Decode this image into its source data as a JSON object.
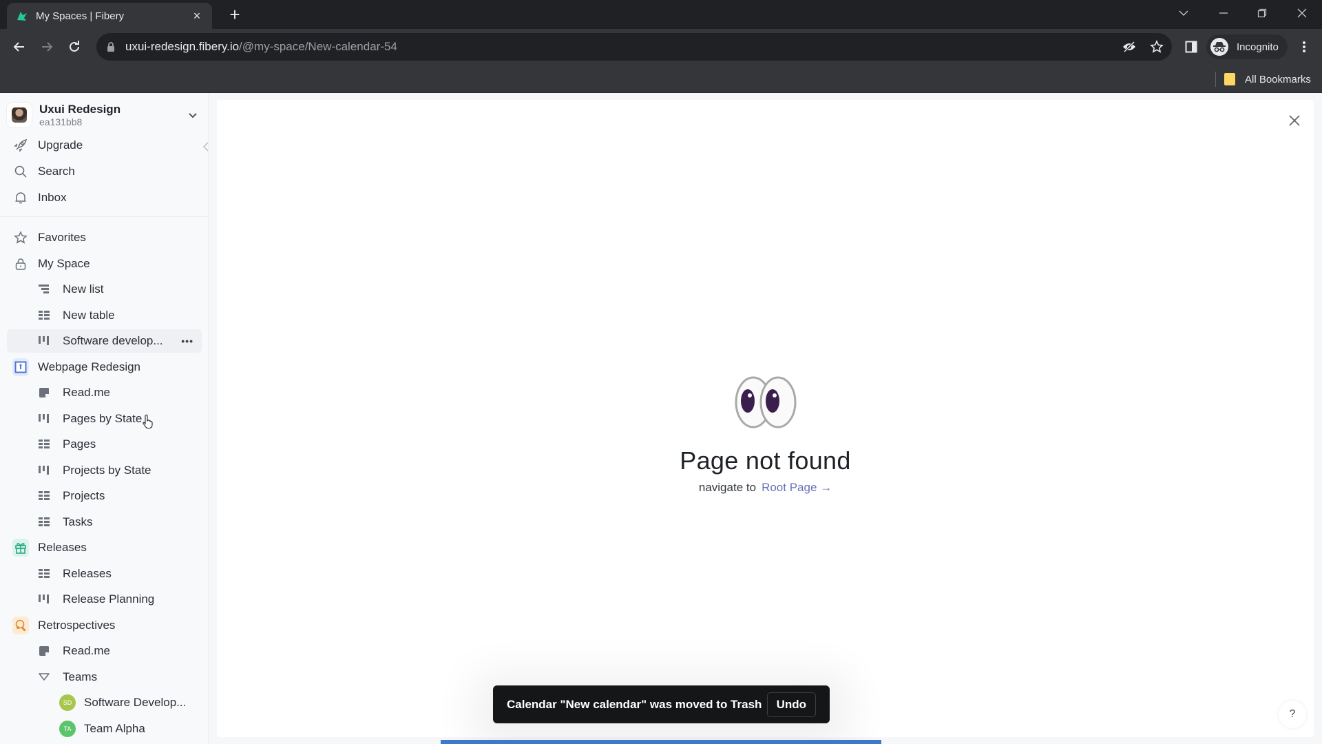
{
  "browser": {
    "tab": {
      "title": "My Spaces | Fibery",
      "close_label": "×"
    },
    "new_tab_label": "+",
    "url_host": "uxui-redesign.fibery.io",
    "url_path": "/@my-space/New-calendar-54",
    "profile_label": "Incognito",
    "bookmarks_label": "All Bookmarks"
  },
  "workspace": {
    "name": "Uxui Redesign",
    "id": "ea131bb8"
  },
  "sidebar": {
    "top_items": [
      {
        "label": "Upgrade",
        "icon": "rocket-icon"
      },
      {
        "label": "Search",
        "icon": "search-icon"
      },
      {
        "label": "Inbox",
        "icon": "bell-icon"
      }
    ],
    "items": [
      {
        "label": "Favorites",
        "icon": "star-icon",
        "level": 0
      },
      {
        "label": "My Space",
        "icon": "lock-icon",
        "level": 0
      },
      {
        "label": "New list",
        "icon": "list-view-icon",
        "level": 1
      },
      {
        "label": "New table",
        "icon": "table-view-icon",
        "level": 1
      },
      {
        "label": "Software develop...",
        "icon": "board-view-icon",
        "level": 1,
        "hovered": true
      },
      {
        "label": "Webpage Redesign",
        "icon": "webpage-space-icon",
        "level": 0
      },
      {
        "label": "Read.me",
        "icon": "document-icon",
        "level": 1
      },
      {
        "label": "Pages by State",
        "icon": "board-view-icon",
        "level": 1
      },
      {
        "label": "Pages",
        "icon": "table-view-icon",
        "level": 1
      },
      {
        "label": "Projects by State",
        "icon": "board-view-icon",
        "level": 1
      },
      {
        "label": "Projects",
        "icon": "table-view-icon",
        "level": 1
      },
      {
        "label": "Tasks",
        "icon": "table-view-icon",
        "level": 1
      },
      {
        "label": "Releases",
        "icon": "gift-space-icon",
        "level": 0
      },
      {
        "label": "Releases",
        "icon": "table-view-icon",
        "level": 1
      },
      {
        "label": "Release Planning",
        "icon": "board-view-icon",
        "level": 1
      },
      {
        "label": "Retrospectives",
        "icon": "retro-space-icon",
        "level": 0
      },
      {
        "label": "Read.me",
        "icon": "document-icon",
        "level": 1
      },
      {
        "label": "Teams",
        "icon": "triangle-down-icon",
        "level": 1
      },
      {
        "label": "Software Develop...",
        "badge": "SD",
        "badge_color": "#a8c64e",
        "level": 2
      },
      {
        "label": "Team Alpha",
        "badge": "TA",
        "badge_color": "#5cc46b",
        "level": 2
      }
    ],
    "more_label": "•••"
  },
  "main": {
    "title": "Page not found",
    "subtitle": "navigate to",
    "link_label": "Root Page →",
    "link_color": "#6772b8"
  },
  "toast": {
    "message": "Calendar \"New calendar\" was moved to Trash",
    "action_label": "Undo"
  },
  "help_label": "?"
}
